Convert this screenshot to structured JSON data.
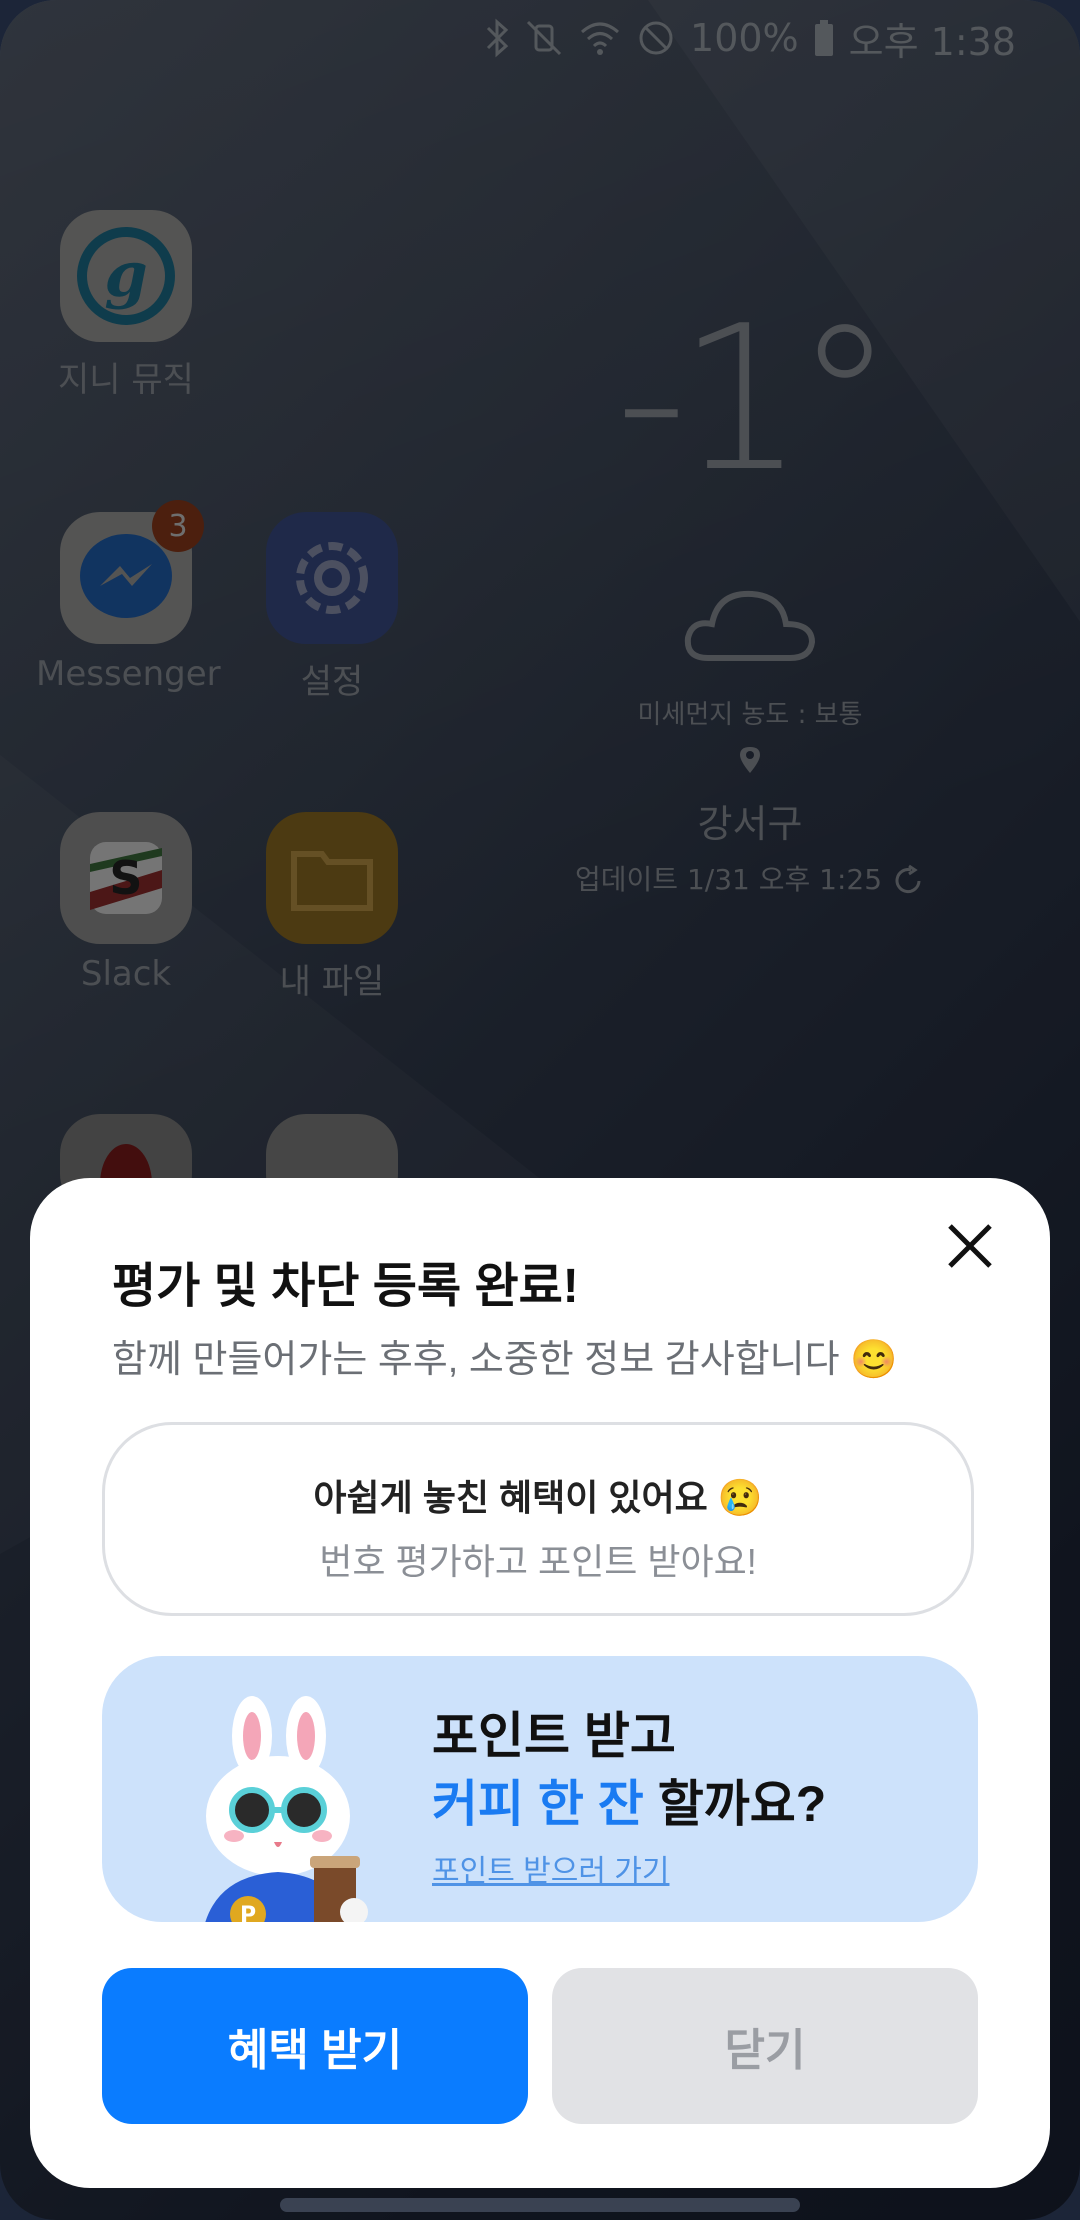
{
  "status_bar": {
    "battery": "100%",
    "time": "오후 1:38"
  },
  "home": {
    "apps": [
      {
        "name": "지니 뮤직",
        "icon": "genie-music-icon"
      },
      {
        "name": "Messenger",
        "icon": "messenger-icon",
        "badge": "3"
      },
      {
        "name": "설정",
        "icon": "settings-gear-icon"
      },
      {
        "name": "Slack",
        "icon": "slack-icon"
      },
      {
        "name": "내 파일",
        "icon": "folder-icon"
      }
    ],
    "weather": {
      "temperature": "-1°",
      "fine_dust": "미세먼지 농도 : 보통",
      "location": "강서구",
      "updated": "업데이트 1/31 오후 1:25"
    }
  },
  "sheet": {
    "title": "평가 및 차단 등록 완료!",
    "subtitle": "함께 만들어가는 후후, 소중한 정보 감사합니다 😊",
    "notice": {
      "line1": "아쉽게 놓친 혜택이 있어요 😢",
      "line2": "번호 평가하고 포인트 받아요!"
    },
    "promo": {
      "line1": "포인트 받고",
      "line2_highlight": "커피 한 잔",
      "line2_rest": " 할까요?",
      "link": "포인트 받으러 가기"
    },
    "primary_button": "혜택 받기",
    "secondary_button": "닫기"
  },
  "colors": {
    "primary": "#0a7cff",
    "promo_bg": "#cde2fb",
    "highlight": "#1a7bf2"
  }
}
